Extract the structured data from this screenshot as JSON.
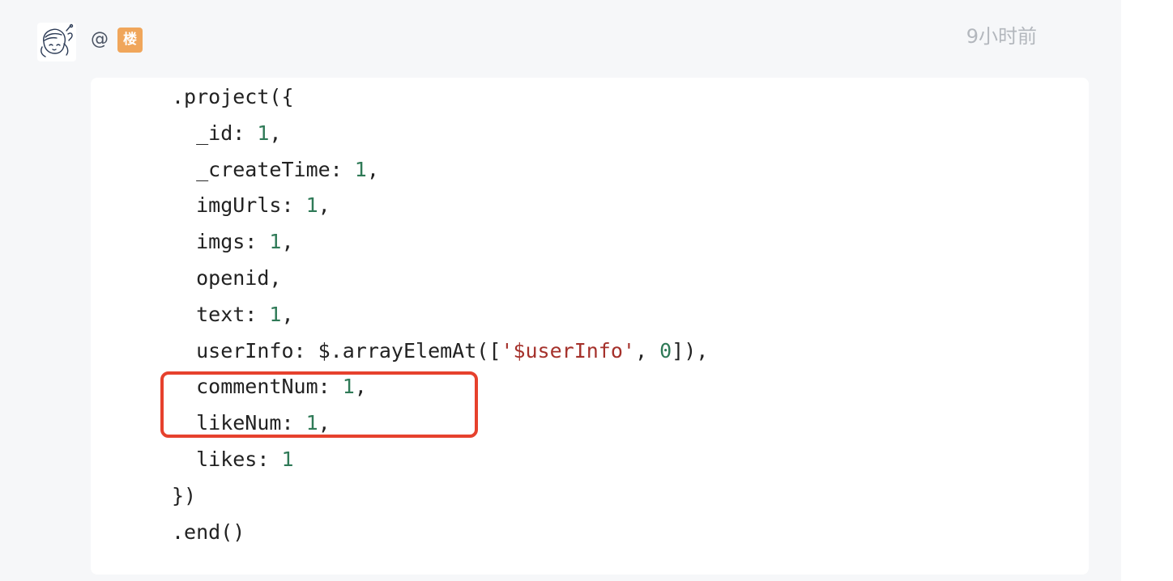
{
  "comment": {
    "mention_symbol": "@",
    "floor_badge": "楼",
    "timestamp": "9小时前"
  },
  "code": {
    "lines": [
      {
        "text": ".project({"
      },
      {
        "text": "  _id: ",
        "num": "1",
        "after": ","
      },
      {
        "text": "  _createTime: ",
        "num": "1",
        "after": ","
      },
      {
        "text": "  imgUrls: ",
        "num": "1",
        "after": ","
      },
      {
        "text": "  imgs: ",
        "num": "1",
        "after": ","
      },
      {
        "text": "  openid,"
      },
      {
        "text": "  text: ",
        "num": "1",
        "after": ","
      },
      {
        "text": "  userInfo: $.arrayElemAt([",
        "str": "'$userInfo'",
        "mid": ", ",
        "num2": "0",
        "after": "]),"
      },
      {
        "text": "  commentNum: ",
        "num": "1",
        "after": ","
      },
      {
        "text": "  likeNum: ",
        "num": "1",
        "after": ","
      },
      {
        "text": "  likes: ",
        "num": "1",
        "after": ""
      },
      {
        "text": "})"
      },
      {
        "text": ".end()"
      }
    ]
  },
  "colors": {
    "panel_bg": "#f6f7f9",
    "code_number": "#2f7a57",
    "code_string": "#a5312b",
    "highlight_border": "#e6412d",
    "badge_bg": "#f0a65b",
    "timestamp": "#b3b7bd"
  },
  "icons": {
    "avatar": "girl-doodle-avatar-icon"
  }
}
